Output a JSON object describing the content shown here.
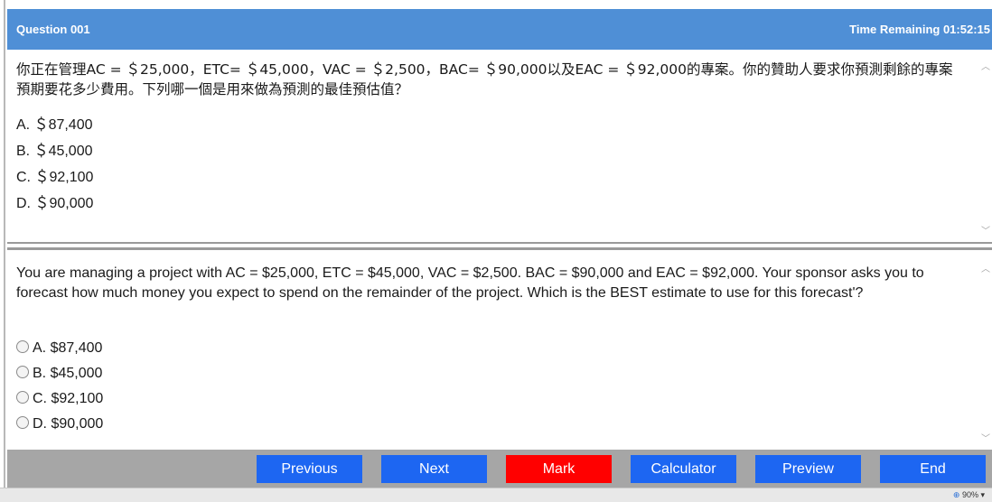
{
  "header": {
    "question_number": "Question 001",
    "time_remaining": "Time Remaining 01:52:15",
    "background_color": "#4f8fd6"
  },
  "chinese_question": {
    "text": "你正在管理AC = ＄25,000，ETC= ＄45,000，VAC = ＄2,500，BAC= ＄90,000以及EAC = ＄92,000的專案。你的贊助人要求你預測剩餘的專案預期要花多少費用。下列哪一個是用來做為預測的最佳預估值？",
    "choices": [
      "A.  ＄87,400",
      "B.  ＄45,000",
      "C.  ＄92,100",
      "D.  ＄90,000"
    ]
  },
  "english_question": {
    "text": "You are managing a project with AC = $25,000, ETC = $45,000, VAC = $2,500. BAC = $90,000 and EAC = $92,000. Your sponsor asks you to forecast how much money you expect to spend on the remainder of the project. Which is the BEST estimate to use for this forecast'?",
    "choices": [
      "A. $87,400",
      "B. $45,000",
      "C. $92,100",
      "D. $90,000"
    ]
  },
  "footer": {
    "buttons": {
      "previous": "Previous",
      "next": "Next",
      "mark": "Mark",
      "calculator": "Calculator",
      "preview": "Preview",
      "end": "End"
    },
    "button_color": "#1d66f2",
    "mark_color": "#ff0000"
  },
  "status_bar": {
    "zoom": "90%"
  }
}
